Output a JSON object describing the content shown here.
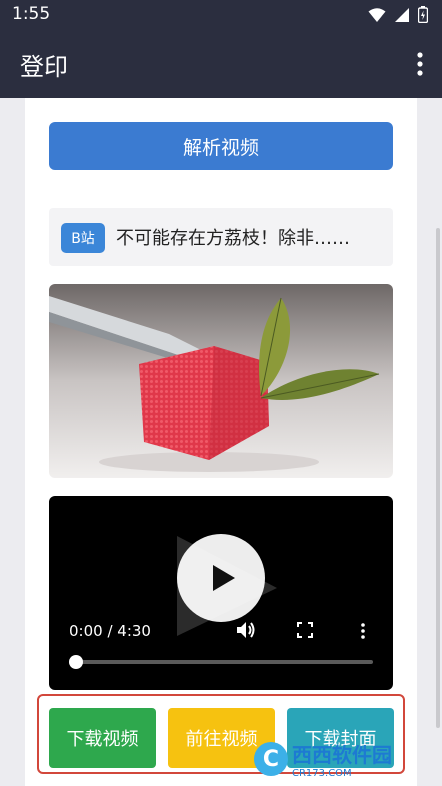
{
  "status_bar": {
    "time": "1:55"
  },
  "app_bar": {
    "title": "登印"
  },
  "parse_button": {
    "label": "解析视频"
  },
  "video_info": {
    "platform_badge": "B站",
    "title": "不可能存在方荔枝！除非……"
  },
  "player": {
    "time_display": "0:00 / 4:30",
    "progress": 0.0
  },
  "actions": {
    "download_video": "下载视频",
    "go_to_video": "前往视频",
    "download_cover": "下载封面"
  },
  "watermark": {
    "brand": "西西软件园",
    "url": "CR173.COM"
  },
  "colors": {
    "bar": "#2b2e3f",
    "primary": "#3b7bd1",
    "green": "#2ea84d",
    "yellow": "#f6c210",
    "teal": "#2aa5b8",
    "frame": "#d2473b"
  }
}
